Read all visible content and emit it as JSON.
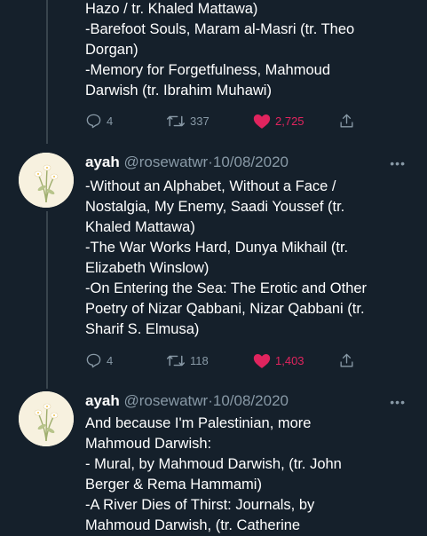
{
  "tweets": [
    {
      "lines": [
        "Hazo / tr. Khaled Mattawa)",
        "-Barefoot Souls, Maram al-Masri (tr. Theo",
        "Dorgan)",
        "-Memory for Forgetfulness, Mahmoud",
        "Darwish (tr. Ibrahim Muhawi)"
      ],
      "actions": {
        "replies": "4",
        "retweets": "337",
        "likes": "2,725"
      }
    },
    {
      "name": "ayah",
      "handle": "@rosewatwr",
      "separator": "·",
      "date": "10/08/2020",
      "more": "•••",
      "lines": [
        "-Without an Alphabet, Without a Face /",
        "Nostalgia, My Enemy, Saadi Youssef (tr.",
        "Khaled Mattawa)",
        "-The War Works Hard, Dunya Mikhail (tr.",
        "Elizabeth Winslow)",
        "-On Entering the Sea: The Erotic and Other",
        "Poetry of Nizar Qabbani, Nizar Qabbani (tr.",
        "Sharif S. Elmusa)"
      ],
      "actions": {
        "replies": "4",
        "retweets": "118",
        "likes": "1,403"
      }
    },
    {
      "name": "ayah",
      "handle": "@rosewatwr",
      "separator": "·",
      "date": "10/08/2020",
      "more": "•••",
      "lines": [
        "And because I'm Palestinian, more",
        "Mahmoud Darwish:",
        "- Mural, by Mahmoud Darwish, (tr. John",
        "Berger & Rema Hammami)",
        "-A River Dies of Thirst: Journals, by",
        "Mahmoud Darwish,  (tr. Catherine"
      ]
    }
  ],
  "icons": {
    "reply": "reply-icon",
    "retweet": "retweet-icon",
    "like": "heart-icon",
    "share": "share-icon"
  },
  "colors": {
    "background": "#15202b",
    "muted": "#8899a6",
    "like": "#e0245e",
    "thread_line": "#38444d"
  }
}
